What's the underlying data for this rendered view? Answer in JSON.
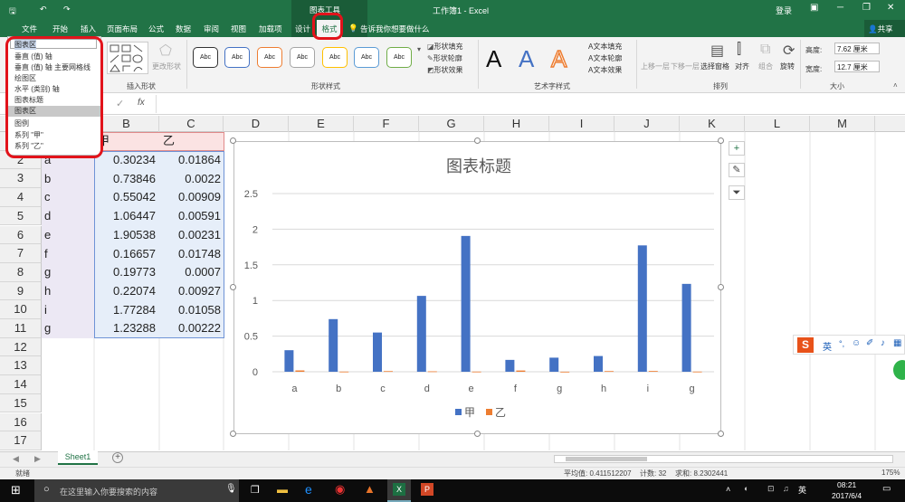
{
  "window": {
    "title": "工作簿1 - Excel",
    "context_group": "图表工具",
    "login": "登录",
    "share": "共享"
  },
  "tabs": [
    "文件",
    "开始",
    "插入",
    "页面布局",
    "公式",
    "数据",
    "审阅",
    "视图",
    "加载项",
    "设计",
    "格式"
  ],
  "tell_me": "告诉我你想要做什么",
  "ribbon": {
    "insert_shapes_label": "插入形状",
    "change_shape": "更改形状",
    "shape_styles_label": "形状样式",
    "shape_style_text": "Abc",
    "shape_fill": "形状填充",
    "shape_outline": "形状轮廓",
    "shape_effects": "形状效果",
    "wordart_label": "艺术字样式",
    "wordart_letter": "A",
    "text_fill": "文本填充",
    "text_outline": "文本轮廓",
    "text_effects": "文本效果",
    "arrange_label": "排列",
    "bring_forward": "上移一层",
    "send_backward": "下移一层",
    "selection_pane": "选择窗格",
    "align": "对齐",
    "group": "组合",
    "rotate": "旋转",
    "size_label": "大小",
    "height_label": "高度:",
    "height_value": "7.62 厘米",
    "width_label": "宽度:",
    "width_value": "12.7 厘米"
  },
  "element_dropdown": {
    "current": "图表区",
    "items": [
      "垂直 (值) 轴",
      "垂直 (值) 轴 主要网格线",
      "绘图区",
      "水平 (类别) 轴",
      "图表标题",
      "图表区",
      "图例",
      "系列 \"甲\"",
      "系列 \"乙\""
    ]
  },
  "formula_bar": {
    "fx": "fx"
  },
  "columns": [
    "B",
    "C",
    "D",
    "E",
    "F",
    "G",
    "H",
    "I",
    "J",
    "K",
    "L",
    "M"
  ],
  "rows": [
    "1",
    "2",
    "3",
    "4",
    "5",
    "6",
    "7",
    "8",
    "9",
    "10",
    "11",
    "12",
    "13",
    "14",
    "15",
    "16",
    "17"
  ],
  "table": {
    "headers": [
      "甲",
      "乙"
    ],
    "labels": [
      "a",
      "b",
      "c",
      "d",
      "e",
      "f",
      "g",
      "h",
      "i",
      "g"
    ],
    "col_b": [
      "0.30234",
      "0.73846",
      "0.55042",
      "1.06447",
      "1.90538",
      "0.16657",
      "0.19773",
      "0.22074",
      "1.77284",
      "1.23288"
    ],
    "col_c": [
      "0.01864",
      "0.0022",
      "0.00909",
      "0.00591",
      "0.00231",
      "0.01748",
      "0.0007",
      "0.00927",
      "0.01058",
      "0.00222"
    ]
  },
  "chart_data": {
    "type": "bar",
    "title": "图表标题",
    "categories": [
      "a",
      "b",
      "c",
      "d",
      "e",
      "f",
      "g",
      "h",
      "i",
      "g"
    ],
    "series": [
      {
        "name": "甲",
        "color": "#4472c4",
        "values": [
          0.30234,
          0.73846,
          0.55042,
          1.06447,
          1.90538,
          0.16657,
          0.19773,
          0.22074,
          1.77284,
          1.23288
        ]
      },
      {
        "name": "乙",
        "color": "#ed7d31",
        "values": [
          0.01864,
          0.0022,
          0.00909,
          0.00591,
          0.00231,
          0.01748,
          0.0007,
          0.00927,
          0.01058,
          0.00222
        ]
      }
    ],
    "yticks": [
      "0",
      "0.5",
      "1",
      "1.5",
      "2",
      "2.5"
    ],
    "ylim": [
      0,
      2.5
    ],
    "grid": true,
    "legend": "bottom"
  },
  "sheet": {
    "tab": "Sheet1",
    "add": "+"
  },
  "status": {
    "ready": "就绪",
    "average": "平均值: 0.411512207",
    "count": "计数: 32",
    "sum": "求和: 8.2302441",
    "zoom": "175%"
  },
  "taskbar": {
    "search": "在这里输入你要搜索的内容",
    "time": "08:21",
    "date": "2017/6/4",
    "lang": "英"
  },
  "ime": {
    "lang": "英"
  }
}
